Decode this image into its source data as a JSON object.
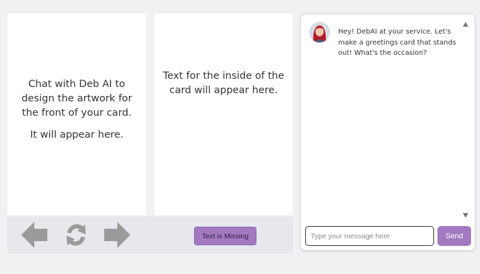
{
  "front_panel": {
    "line1": "Chat with Deb AI to design the artwork for the front of your card.",
    "line2": "It will appear here."
  },
  "inside_panel": {
    "text": "Text for the inside of the card will appear here."
  },
  "controls": {
    "back_icon": "left-arrow-icon",
    "refresh_icon": "refresh-icon",
    "forward_icon": "right-arrow-icon",
    "icon_color": "#9a9a9a",
    "text_missing_label": "Text is Missing"
  },
  "chat": {
    "avatar_icon": "assistant-avatar",
    "bot_message": "Hey! DebAI at your service. Let's make a greetings card that stands out! What's the occasion?",
    "input_placeholder": "Type your message here",
    "input_value": "",
    "send_label": "Send"
  },
  "colors": {
    "accent": "#a37ac2",
    "background": "#f1f1f3"
  }
}
